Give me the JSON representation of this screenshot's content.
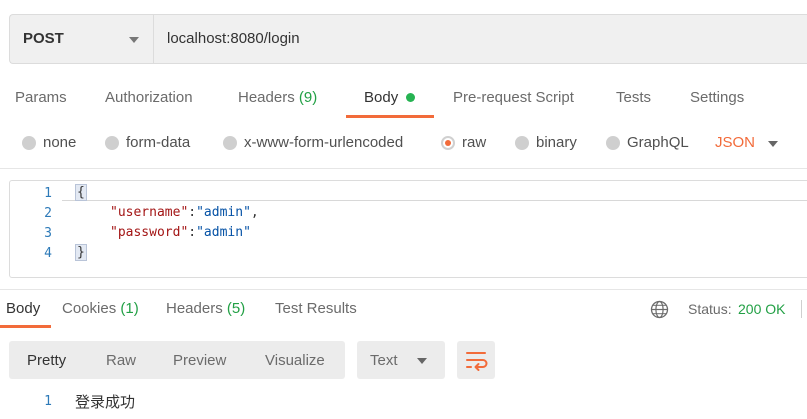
{
  "request": {
    "method": "POST",
    "url": "localhost:8080/login"
  },
  "request_tabs": {
    "params": "Params",
    "authorization": "Authorization",
    "headers": "Headers",
    "headers_count": "(9)",
    "body": "Body",
    "pre_request": "Pre-request Script",
    "tests": "Tests",
    "settings": "Settings"
  },
  "body_types": {
    "none": "none",
    "form_data": "form-data",
    "urlencoded": "x-www-form-urlencoded",
    "raw": "raw",
    "binary": "binary",
    "graphql": "GraphQL",
    "format": "JSON",
    "selected": "raw"
  },
  "editor": {
    "line_numbers": [
      "1",
      "2",
      "3",
      "4"
    ],
    "open_brace": "{",
    "close_brace": "}",
    "lines": [
      {
        "key": "\"username\"",
        "sep": ":",
        "value": "\"admin\"",
        "end": ","
      },
      {
        "key": "\"password\"",
        "sep": ":",
        "value": "\"admin\"",
        "end": ""
      }
    ]
  },
  "response_tabs": {
    "body": "Body",
    "cookies": "Cookies",
    "cookies_count": "(1)",
    "headers": "Headers",
    "headers_count": "(5)",
    "test_results": "Test Results"
  },
  "status": {
    "label": "Status:",
    "value": "200 OK"
  },
  "response_toolbar": {
    "pretty": "Pretty",
    "raw": "Raw",
    "preview": "Preview",
    "visualize": "Visualize",
    "format": "Text"
  },
  "response_body": {
    "line_number": "1",
    "text": "登录成功"
  },
  "colors": {
    "accent": "#f26b3a",
    "success": "#22a045",
    "key": "#a31515",
    "string": "#0451a5"
  }
}
